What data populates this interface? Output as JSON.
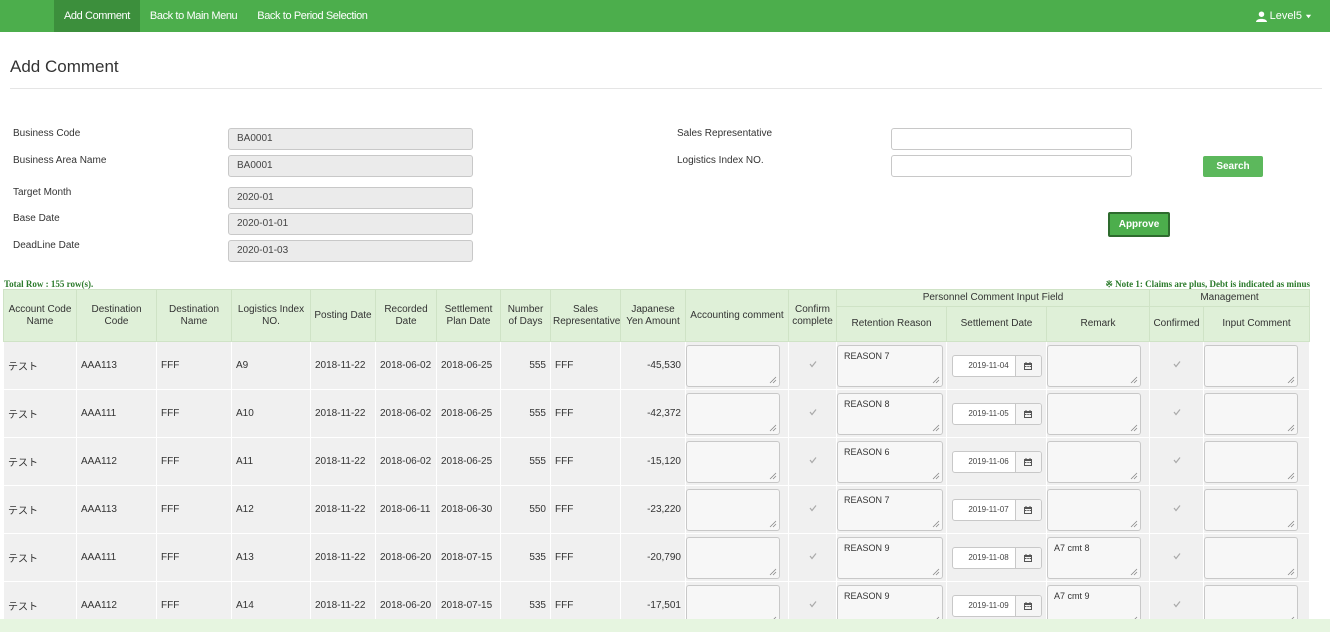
{
  "nav": {
    "items": [
      {
        "label": "Add Comment",
        "active": true
      },
      {
        "label": "Back to Main Menu",
        "active": false
      },
      {
        "label": "Back to Period Selection",
        "active": false
      }
    ],
    "user": "Level5"
  },
  "page_title": "Add Comment",
  "form": {
    "business_code": {
      "label": "Business Code",
      "value": "BA0001"
    },
    "business_area_name": {
      "label": "Business Area Name",
      "value": "BA0001"
    },
    "target_month": {
      "label": "Target Month",
      "value": "2020-01"
    },
    "base_date": {
      "label": "Base Date",
      "value": "2020-01-01"
    },
    "deadline_date": {
      "label": "DeadLine Date",
      "value": "2020-01-03"
    },
    "sales_representative": {
      "label": "Sales Representative",
      "value": ""
    },
    "logistics_index_no": {
      "label": "Logistics Index NO.",
      "value": ""
    },
    "search_label": "Search",
    "approve_label": "Approve"
  },
  "total_row_text": "Total Row : 155 row(s).",
  "note_text": "※ Note 1: Claims are plus, Debt is indicated as minus",
  "table": {
    "group_headers": {
      "personnel": "Personnel Comment Input Field",
      "management": "Management"
    },
    "headers": [
      "Account Code Name",
      "Destination Code",
      "Destination Name",
      "Logistics Index NO.",
      "Posting Date",
      "Recorded Date",
      "Settlement Plan Date",
      "Number of Days",
      "Sales Representative",
      "Japanese Yen Amount",
      "Accounting comment",
      "Confirm complete",
      "Retention Reason",
      "Settlement Date",
      "Remark",
      "Confirmed",
      "Input Comment"
    ],
    "rows": [
      {
        "account": "テスト",
        "dest_code": "AAA113",
        "dest_name": "FFF",
        "logistics": "A9",
        "posting": "2018-11-22",
        "recorded": "2018-06-02",
        "settlement_plan": "2018-06-25",
        "days": "555",
        "sales_rep": "FFF",
        "amount": "-45,530",
        "accounting_comment": "",
        "retention_reason": "REASON 7",
        "settlement_date": "2019-11-04",
        "remark": "",
        "input_comment": ""
      },
      {
        "account": "テスト",
        "dest_code": "AAA111",
        "dest_name": "FFF",
        "logistics": "A10",
        "posting": "2018-11-22",
        "recorded": "2018-06-02",
        "settlement_plan": "2018-06-25",
        "days": "555",
        "sales_rep": "FFF",
        "amount": "-42,372",
        "accounting_comment": "",
        "retention_reason": "REASON 8",
        "settlement_date": "2019-11-05",
        "remark": "",
        "input_comment": ""
      },
      {
        "account": "テスト",
        "dest_code": "AAA112",
        "dest_name": "FFF",
        "logistics": "A11",
        "posting": "2018-11-22",
        "recorded": "2018-06-02",
        "settlement_plan": "2018-06-25",
        "days": "555",
        "sales_rep": "FFF",
        "amount": "-15,120",
        "accounting_comment": "",
        "retention_reason": "REASON 6",
        "settlement_date": "2019-11-06",
        "remark": "",
        "input_comment": ""
      },
      {
        "account": "テスト",
        "dest_code": "AAA113",
        "dest_name": "FFF",
        "logistics": "A12",
        "posting": "2018-11-22",
        "recorded": "2018-06-11",
        "settlement_plan": "2018-06-30",
        "days": "550",
        "sales_rep": "FFF",
        "amount": "-23,220",
        "accounting_comment": "",
        "retention_reason": "REASON 7",
        "settlement_date": "2019-11-07",
        "remark": "",
        "input_comment": ""
      },
      {
        "account": "テスト",
        "dest_code": "AAA111",
        "dest_name": "FFF",
        "logistics": "A13",
        "posting": "2018-11-22",
        "recorded": "2018-06-20",
        "settlement_plan": "2018-07-15",
        "days": "535",
        "sales_rep": "FFF",
        "amount": "-20,790",
        "accounting_comment": "",
        "retention_reason": "REASON 9",
        "settlement_date": "2019-11-08",
        "remark": "A7 cmt 8",
        "input_comment": ""
      },
      {
        "account": "テスト",
        "dest_code": "AAA112",
        "dest_name": "FFF",
        "logistics": "A14",
        "posting": "2018-11-22",
        "recorded": "2018-06-20",
        "settlement_plan": "2018-07-15",
        "days": "535",
        "sales_rep": "FFF",
        "amount": "-17,501",
        "accounting_comment": "",
        "retention_reason": "REASON 9",
        "settlement_date": "2019-11-09",
        "remark": "A7 cmt 9",
        "input_comment": ""
      }
    ]
  },
  "colors": {
    "nav_bg": "#4cae4c",
    "nav_active": "#3c8f3c",
    "header_bg": "#dff0d8",
    "accent_green": "#5cb85c"
  },
  "icons": {
    "user": "user-icon",
    "caret": "caret-down-icon",
    "calendar": "calendar-icon",
    "check": "check-icon",
    "resize": "resize-grip-icon"
  }
}
